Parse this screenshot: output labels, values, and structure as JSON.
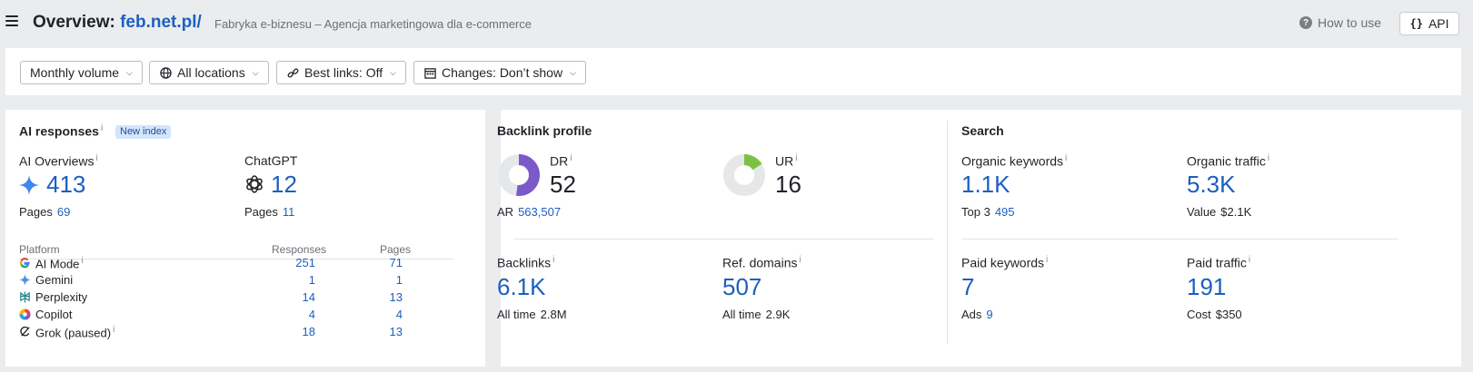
{
  "header": {
    "title_prefix": "Overview:",
    "domain": "feb.net.pl/",
    "subtitle": "Fabryka e-biznesu – Agencja marketingowa dla e-commerce",
    "how_to_use": "How to use",
    "api": "API"
  },
  "filters": {
    "volume": "Monthly volume",
    "locations": "All locations",
    "best_links": "Best links: Off",
    "changes": "Changes: Don’t show"
  },
  "ai_responses": {
    "title": "AI responses",
    "info": "i",
    "badge": "New index",
    "ai_overviews": {
      "label": "AI Overviews",
      "value": "413",
      "pages_label": "Pages",
      "pages_value": "69"
    },
    "chatgpt": {
      "label": "ChatGPT",
      "value": "12",
      "pages_label": "Pages",
      "pages_value": "11"
    },
    "table": {
      "headers": [
        "Platform",
        "Responses",
        "Pages"
      ],
      "rows": [
        {
          "name": "AI Mode",
          "info": "i",
          "responses": "251",
          "pages": "71",
          "icon": "google-icon"
        },
        {
          "name": "Gemini",
          "info": "",
          "responses": "1",
          "pages": "1",
          "icon": "gemini-icon"
        },
        {
          "name": "Perplexity",
          "info": "",
          "responses": "14",
          "pages": "13",
          "icon": "perplexity-icon"
        },
        {
          "name": "Copilot",
          "info": "",
          "responses": "4",
          "pages": "4",
          "icon": "copilot-icon"
        },
        {
          "name": "Grok (paused)",
          "info": "i",
          "responses": "18",
          "pages": "13",
          "icon": "grok-icon"
        }
      ]
    }
  },
  "backlink_profile": {
    "title": "Backlink profile",
    "dr": {
      "label": "DR",
      "value": "52",
      "fraction": 0.52,
      "color": "#7a5ac9"
    },
    "ur": {
      "label": "UR",
      "value": "16",
      "fraction": 0.16,
      "color": "#7cc242"
    },
    "ar": {
      "label": "AR",
      "value": "563,507"
    },
    "backlinks": {
      "label": "Backlinks",
      "value": "6.1K",
      "sub_label": "All time",
      "sub_value": "2.8M"
    },
    "ref_domains": {
      "label": "Ref. domains",
      "value": "507",
      "sub_label": "All time",
      "sub_value": "2.9K"
    }
  },
  "search": {
    "title": "Search",
    "organic_keywords": {
      "label": "Organic keywords",
      "value": "1.1K",
      "sub_label": "Top 3",
      "sub_value": "495"
    },
    "organic_traffic": {
      "label": "Organic traffic",
      "value": "5.3K",
      "sub_label": "Value",
      "sub_value": "$2.1K"
    },
    "paid_keywords": {
      "label": "Paid keywords",
      "value": "7",
      "sub_label": "Ads",
      "sub_value": "9"
    },
    "paid_traffic": {
      "label": "Paid traffic",
      "value": "191",
      "sub_label": "Cost",
      "sub_value": "$350"
    }
  },
  "colors": {
    "link": "#1d5fbf",
    "badge_bg": "#d4e4fb",
    "donut_track": "#e6e7e9"
  }
}
